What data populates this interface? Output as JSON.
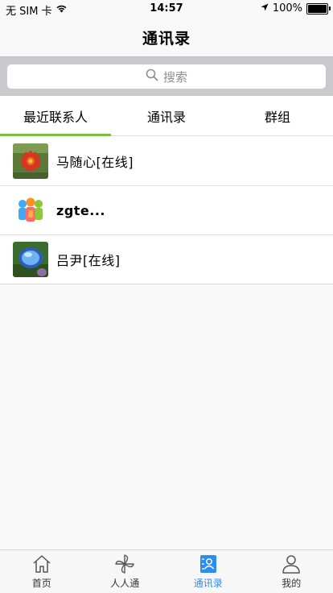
{
  "status_bar": {
    "carrier": "无 SIM 卡",
    "time": "14:57",
    "battery": "100%",
    "icons": [
      "wifi-icon",
      "location-arrow-icon",
      "battery-icon"
    ]
  },
  "nav": {
    "title": "通讯录"
  },
  "search": {
    "placeholder": "搜索"
  },
  "tabs": [
    {
      "label": "最近联系人",
      "active": true
    },
    {
      "label": "通讯录",
      "active": false
    },
    {
      "label": "群组",
      "active": false
    }
  ],
  "contacts": [
    {
      "name": "马随心[在线]",
      "avatar": "red-flower-avatar"
    },
    {
      "name": "zgte...",
      "avatar": "colorful-people-avatar"
    },
    {
      "name": "吕尹[在线]",
      "avatar": "water-drop-avatar"
    }
  ],
  "tab_bar": [
    {
      "label": "首页",
      "icon": "home-icon",
      "active": false
    },
    {
      "label": "人人通",
      "icon": "pinwheel-icon",
      "active": false
    },
    {
      "label": "通讯录",
      "icon": "contacts-book-icon",
      "active": true
    },
    {
      "label": "我的",
      "icon": "person-icon",
      "active": false
    }
  ],
  "colors": {
    "accent_green": "#7ac142",
    "accent_blue": "#2d8cf0"
  }
}
